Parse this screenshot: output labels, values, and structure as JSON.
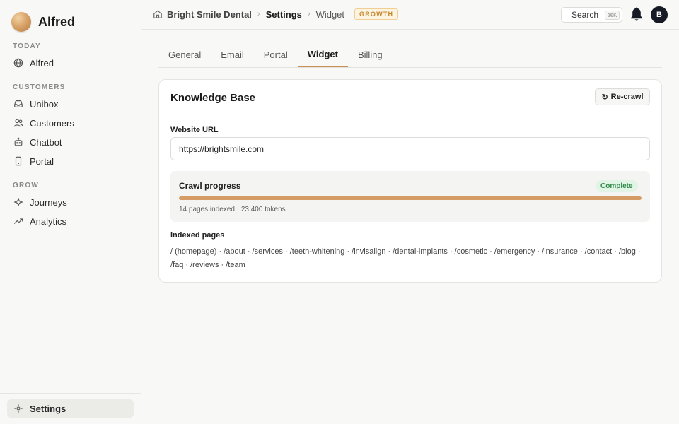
{
  "app": {
    "name": "Alfred"
  },
  "sidebar": {
    "sections": [
      {
        "title": "TODAY",
        "items": [
          {
            "label": "Alfred",
            "icon": "globe-icon"
          }
        ]
      },
      {
        "title": "CUSTOMERS",
        "items": [
          {
            "label": "Unibox",
            "icon": "inbox-icon"
          },
          {
            "label": "Customers",
            "icon": "users-icon"
          },
          {
            "label": "Chatbot",
            "icon": "bot-icon"
          },
          {
            "label": "Portal",
            "icon": "phone-icon"
          }
        ]
      },
      {
        "title": "GROW",
        "items": [
          {
            "label": "Journeys",
            "icon": "sparkle-icon"
          },
          {
            "label": "Analytics",
            "icon": "trend-icon"
          }
        ]
      }
    ],
    "footer_item": {
      "label": "Settings",
      "icon": "gear-icon",
      "active": true
    }
  },
  "topbar": {
    "breadcrumb": {
      "org": "Bright Smile Dental",
      "section": "Settings",
      "page": "Widget",
      "separator": "›"
    },
    "plan_badge": "GROWTH",
    "search": {
      "label": "Search",
      "shortcut": "⌘K"
    },
    "avatar_initial": "B"
  },
  "tabs": [
    {
      "label": "General",
      "active": false
    },
    {
      "label": "Email",
      "active": false
    },
    {
      "label": "Portal",
      "active": false
    },
    {
      "label": "Widget",
      "active": true
    },
    {
      "label": "Billing",
      "active": false
    }
  ],
  "knowledge_base": {
    "title": "Knowledge Base",
    "recrawl_label": "Re-crawl",
    "recrawl_glyph": "↻",
    "website_url_label": "Website URL",
    "website_url_value": "https://brightsmile.com",
    "crawl": {
      "title": "Crawl progress",
      "status": "Complete",
      "progress_percent": 100,
      "meta": "14 pages indexed · 23,400 tokens"
    },
    "indexed_pages_title": "Indexed pages",
    "indexed_pages_text": "/ (homepage) · /about · /services · /teeth-whitening · /invisalign · /dental-implants · /cosmetic · /emergency · /insurance · /contact · /blog · /faq · /reviews · /team"
  },
  "colors": {
    "accent": "#c98f55",
    "progress": "#d69c66",
    "badge_text": "#c6862a",
    "status_green": "#2f8a46",
    "avatar_bg": "#151a24"
  }
}
